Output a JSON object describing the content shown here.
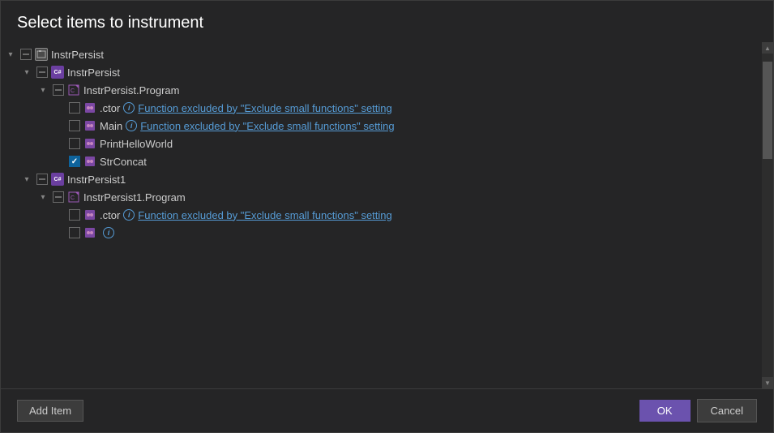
{
  "dialog": {
    "title": "Select items to instrument",
    "add_item_label": "Add Item",
    "ok_label": "OK",
    "cancel_label": "Cancel"
  },
  "tree": {
    "items": [
      {
        "id": "instrpersist-solution",
        "indent": 0,
        "expander": "open",
        "checkbox": "indeterminate",
        "icon": "solution",
        "label": "InstrPersist",
        "info": false,
        "link": ""
      },
      {
        "id": "instrpersist-project",
        "indent": 1,
        "expander": "open",
        "checkbox": "indeterminate",
        "icon": "csharp",
        "label": "InstrPersist",
        "info": false,
        "link": ""
      },
      {
        "id": "instrpersist-program",
        "indent": 2,
        "expander": "open",
        "checkbox": "indeterminate",
        "icon": "class",
        "label": "InstrPersist.Program",
        "info": false,
        "link": ""
      },
      {
        "id": "ctor1",
        "indent": 3,
        "expander": "none",
        "checkbox": "unchecked",
        "icon": "method",
        "label": ".ctor",
        "info": true,
        "link": "Function excluded by \"Exclude small functions\" setting"
      },
      {
        "id": "main",
        "indent": 3,
        "expander": "none",
        "checkbox": "unchecked",
        "icon": "method",
        "label": "Main",
        "info": true,
        "link": "Function excluded by \"Exclude small functions\" setting"
      },
      {
        "id": "printhelloworld",
        "indent": 3,
        "expander": "none",
        "checkbox": "unchecked",
        "icon": "method",
        "label": "PrintHelloWorld",
        "info": false,
        "link": ""
      },
      {
        "id": "strconcat",
        "indent": 3,
        "expander": "none",
        "checkbox": "checked",
        "icon": "method",
        "label": "StrConcat",
        "info": false,
        "link": ""
      },
      {
        "id": "instrpersist1-project",
        "indent": 1,
        "expander": "open",
        "checkbox": "indeterminate",
        "icon": "csharp",
        "label": "InstrPersist1",
        "info": false,
        "link": ""
      },
      {
        "id": "instrpersist1-program",
        "indent": 2,
        "expander": "open",
        "checkbox": "indeterminate",
        "icon": "class",
        "label": "InstrPersist1.Program",
        "info": false,
        "link": ""
      },
      {
        "id": "ctor2",
        "indent": 3,
        "expander": "none",
        "checkbox": "unchecked",
        "icon": "method",
        "label": ".ctor",
        "info": true,
        "link": "Function excluded by \"Exclude small functions\" setting"
      },
      {
        "id": "main2",
        "indent": 3,
        "expander": "none",
        "checkbox": "unchecked",
        "icon": "method",
        "label": "",
        "info": true,
        "link": ""
      }
    ]
  },
  "icons": {
    "solution": "⊞",
    "csharp": "C#",
    "class": "◇",
    "method": "●",
    "info": "i",
    "expand_open": "▾",
    "expand_closed": "▸",
    "scroll_up": "▲",
    "scroll_down": "▼"
  }
}
